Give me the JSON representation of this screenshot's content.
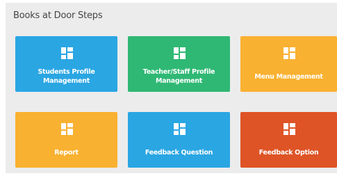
{
  "page": {
    "title": "Books at Door Steps"
  },
  "tiles": [
    {
      "lines": [
        "Students Profile",
        "Management"
      ],
      "color": "#2aa6e3",
      "icon": "grid-icon"
    },
    {
      "lines": [
        "Teacher/Staff Profile",
        "Management"
      ],
      "color": "#2fb874",
      "icon": "grid-icon"
    },
    {
      "lines": [
        "Menu Management"
      ],
      "color": "#f9b131",
      "icon": "grid-icon"
    },
    {
      "lines": [
        "Report"
      ],
      "color": "#f9b131",
      "icon": "grid-icon"
    },
    {
      "lines": [
        "Feedback Question"
      ],
      "color": "#2aa6e3",
      "icon": "grid-icon"
    },
    {
      "lines": [
        "Feedback Option"
      ],
      "color": "#de5426",
      "icon": "grid-icon"
    }
  ]
}
